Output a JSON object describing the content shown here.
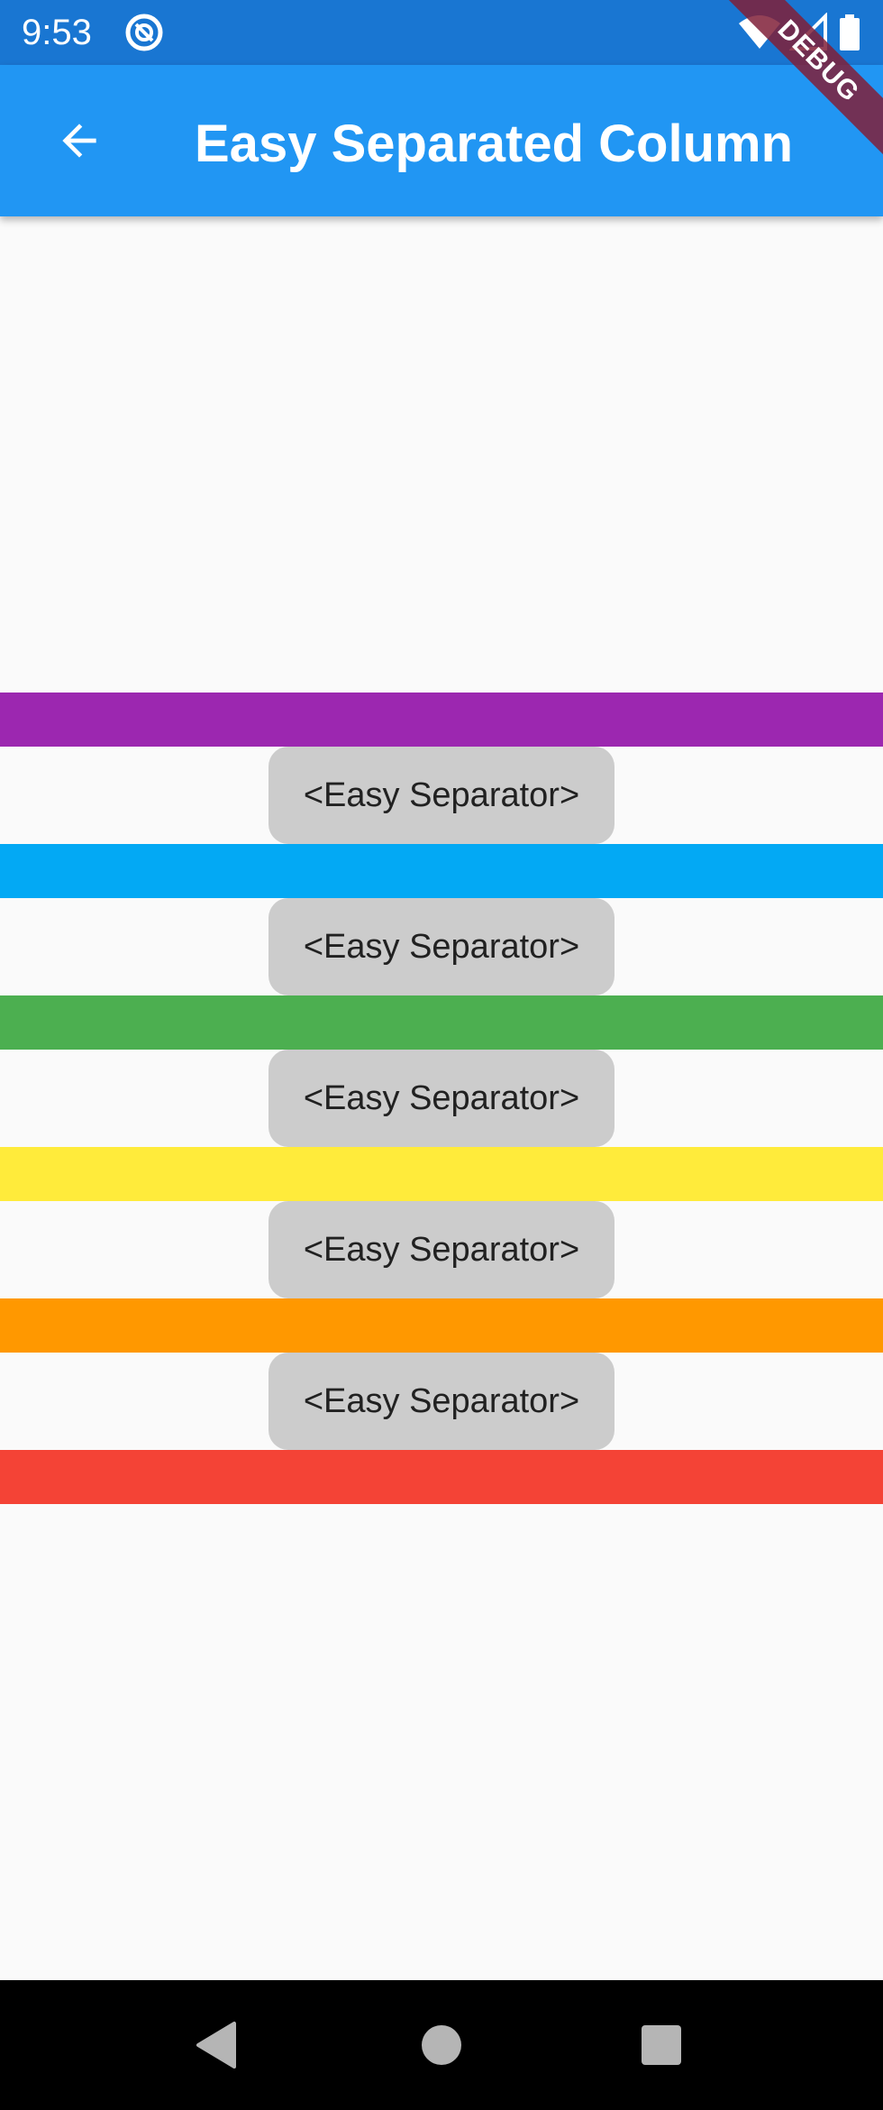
{
  "status_bar": {
    "time": "9:53",
    "icons": [
      "app-notification-icon",
      "wifi-icon",
      "cellular-signal-icon",
      "battery-icon"
    ],
    "background": "#1976d2"
  },
  "app_bar": {
    "title": "Easy Separated Column",
    "back_icon": "arrow-back-icon",
    "background": "#2196f3"
  },
  "debug_banner": {
    "label": "DEBUG"
  },
  "column": {
    "bars": [
      {
        "name": "purple",
        "color": "#9c27b0"
      },
      {
        "name": "light-blue",
        "color": "#03a9f4"
      },
      {
        "name": "green",
        "color": "#4caf50"
      },
      {
        "name": "yellow",
        "color": "#ffeb3b"
      },
      {
        "name": "orange",
        "color": "#ff9800"
      },
      {
        "name": "red",
        "color": "#f44336"
      }
    ],
    "separators": [
      {
        "label": "<Easy Separator>"
      },
      {
        "label": "<Easy Separator>"
      },
      {
        "label": "<Easy Separator>"
      },
      {
        "label": "<Easy Separator>"
      },
      {
        "label": "<Easy Separator>"
      }
    ],
    "separator_color": "#cccccc"
  },
  "nav_bar": {
    "buttons": [
      "nav-back-icon",
      "nav-home-icon",
      "nav-recents-icon"
    ]
  }
}
